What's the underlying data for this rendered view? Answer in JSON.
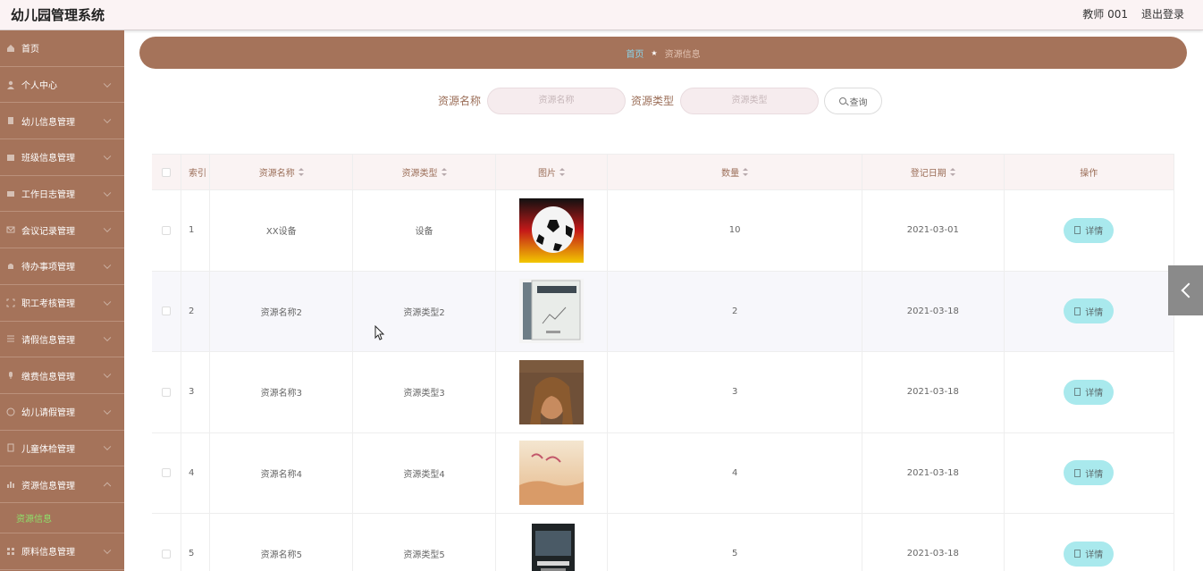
{
  "header": {
    "app_title": "幼儿园管理系统",
    "user_name": "教师 001",
    "logout_label": "退出登录"
  },
  "sidebar": {
    "items": [
      {
        "label": "首页",
        "icon": "home-icon"
      },
      {
        "label": "个人中心",
        "icon": "user-icon"
      },
      {
        "label": "幼儿信息管理",
        "icon": "file-icon"
      },
      {
        "label": "班级信息管理",
        "icon": "folder-icon"
      },
      {
        "label": "工作日志管理",
        "icon": "book-icon"
      },
      {
        "label": "会议记录管理",
        "icon": "mail-icon"
      },
      {
        "label": "待办事项管理",
        "icon": "bell-icon"
      },
      {
        "label": "职工考核管理",
        "icon": "expand-icon"
      },
      {
        "label": "请假信息管理",
        "icon": "list-icon"
      },
      {
        "label": "缴费信息管理",
        "icon": "mic-icon"
      },
      {
        "label": "幼儿请假管理",
        "icon": "compass-icon"
      },
      {
        "label": "儿童体检管理",
        "icon": "building-icon"
      },
      {
        "label": "资源信息管理",
        "icon": "chart-icon"
      }
    ],
    "sub_item": "资源信息",
    "last_item": {
      "label": "原料信息管理",
      "icon": "grid-icon"
    }
  },
  "breadcrumb": {
    "home": "首页",
    "current": "资源信息"
  },
  "search": {
    "name_label": "资源名称",
    "name_placeholder": "资源名称",
    "type_label": "资源类型",
    "type_placeholder": "资源类型",
    "button_label": "查询"
  },
  "table": {
    "columns": {
      "index": "索引",
      "name": "资源名称",
      "type": "资源类型",
      "image": "图片",
      "quantity": "数量",
      "date": "登记日期",
      "ops": "操作"
    },
    "detail_label": "详情",
    "rows": [
      {
        "index": "1",
        "name": "XX设备",
        "type": "设备",
        "quantity": "10",
        "date": "2021-03-01",
        "image": "soccer-ball"
      },
      {
        "index": "2",
        "name": "资源名称2",
        "type": "资源类型2",
        "quantity": "2",
        "date": "2021-03-18",
        "image": "book-cover"
      },
      {
        "index": "3",
        "name": "资源名称3",
        "type": "资源类型3",
        "quantity": "3",
        "date": "2021-03-18",
        "image": "magazine-cover"
      },
      {
        "index": "4",
        "name": "资源名称4",
        "type": "资源类型4",
        "quantity": "4",
        "date": "2021-03-18",
        "image": "field-photo"
      },
      {
        "index": "5",
        "name": "资源名称5",
        "type": "资源类型5",
        "quantity": "5",
        "date": "2021-03-18",
        "image": "dark-book-cover"
      }
    ]
  },
  "colors": {
    "primary": "#a5735a",
    "accent_link": "#8ad3e9",
    "detail_button": "#a9e9ed",
    "active_sub": "#8ee06a"
  }
}
